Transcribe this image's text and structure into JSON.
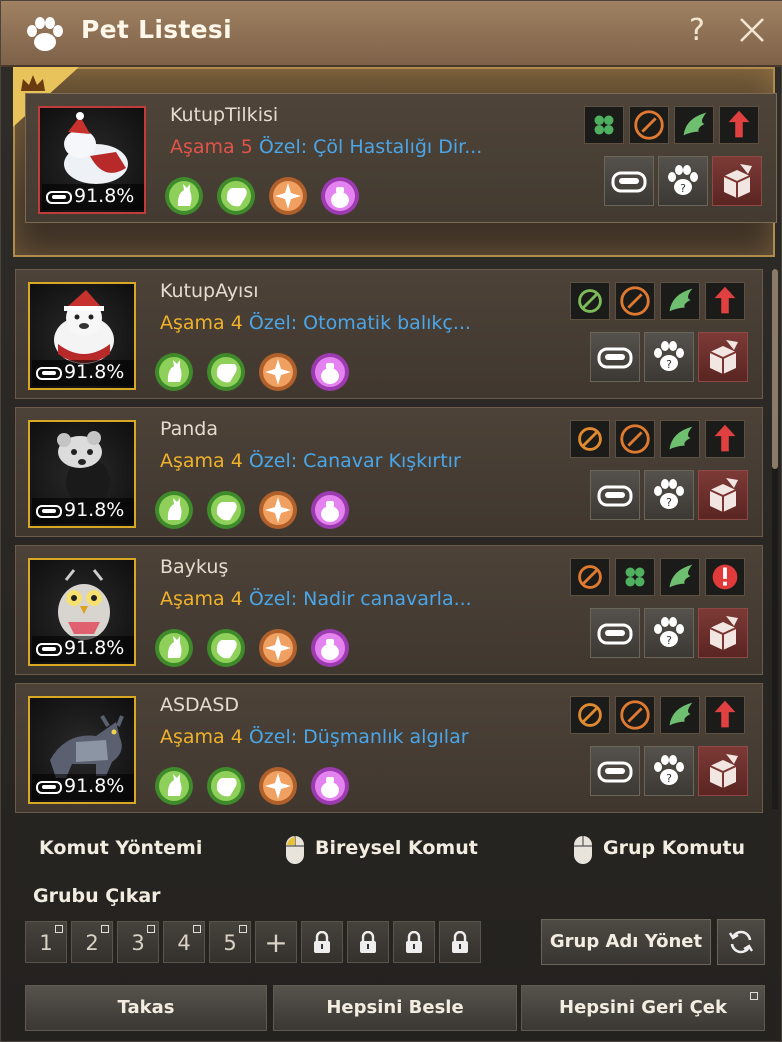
{
  "window": {
    "title": "Pet Listesi",
    "help_label": "?"
  },
  "pets": [
    {
      "name": "KutupTilkisi",
      "stage": "Aşama 5",
      "special": "Özel: Çöl Hastalığı Dir...",
      "feed_percent": "91.8%",
      "featured": true,
      "traits": [
        "clover-icon",
        "axe-icon",
        "wing-icon",
        "arrow-up-icon"
      ],
      "skills": [
        "cat-skill-icon",
        "hand-skill-icon",
        "compass-skill-icon",
        "bag-skill-icon"
      ]
    },
    {
      "name": "KutupAyısı",
      "stage": "Aşama 4",
      "special": "Özel: Otomatik balıkç...",
      "feed_percent": "91.8%",
      "traits": [
        "fishing-icon",
        "axe-icon",
        "wing-icon",
        "arrow-up-icon"
      ],
      "skills": [
        "cat-skill-icon",
        "hand-skill-icon",
        "compass-skill-icon",
        "bag-skill-icon"
      ]
    },
    {
      "name": "Panda",
      "stage": "Aşama 4",
      "special": "Özel: Canavar Kışkırtır",
      "feed_percent": "91.8%",
      "traits": [
        "rank-icon",
        "axe-icon",
        "wing-icon",
        "arrow-up-icon"
      ],
      "skills": [
        "cat-skill-icon",
        "hand-skill-icon",
        "compass-skill-icon",
        "bag-skill-icon"
      ]
    },
    {
      "name": "Baykuş",
      "stage": "Aşama 4",
      "special": "Özel: Nadir canavarla...",
      "feed_percent": "91.8%",
      "traits": [
        "horse-icon",
        "clover-icon",
        "wing-icon",
        "alert-icon"
      ],
      "skills": [
        "cat-skill-icon",
        "hand-skill-icon",
        "compass-skill-icon",
        "bag-skill-icon"
      ]
    },
    {
      "name": "ASDASD",
      "stage": "Aşama 4",
      "special": "Özel: Düşmanlık algılar",
      "feed_percent": "91.8%",
      "traits": [
        "food-icon",
        "axe-icon",
        "wing-icon",
        "arrow-up-icon"
      ],
      "skills": [
        "cat-skill-icon",
        "hand-skill-icon",
        "compass-skill-icon",
        "bag-skill-icon"
      ]
    }
  ],
  "command": {
    "method_label": "Komut Yöntemi",
    "individual_label": "Bireysel Komut",
    "group_label": "Grup Komutu"
  },
  "groups": {
    "title": "Grubu Çıkar",
    "numbers": [
      "1",
      "2",
      "3",
      "4",
      "5"
    ],
    "add_label": "+",
    "manage_label": "Grup Adı Yönet"
  },
  "footer": {
    "trade_label": "Takas",
    "feed_all_label": "Hepsini Besle",
    "recall_all_label": "Hepsini Geri Çek"
  },
  "colors": {
    "stage_normal": "#f0b22a",
    "stage_max": "#e2544a",
    "special": "#4aa6e8",
    "header": "#8e7256"
  }
}
